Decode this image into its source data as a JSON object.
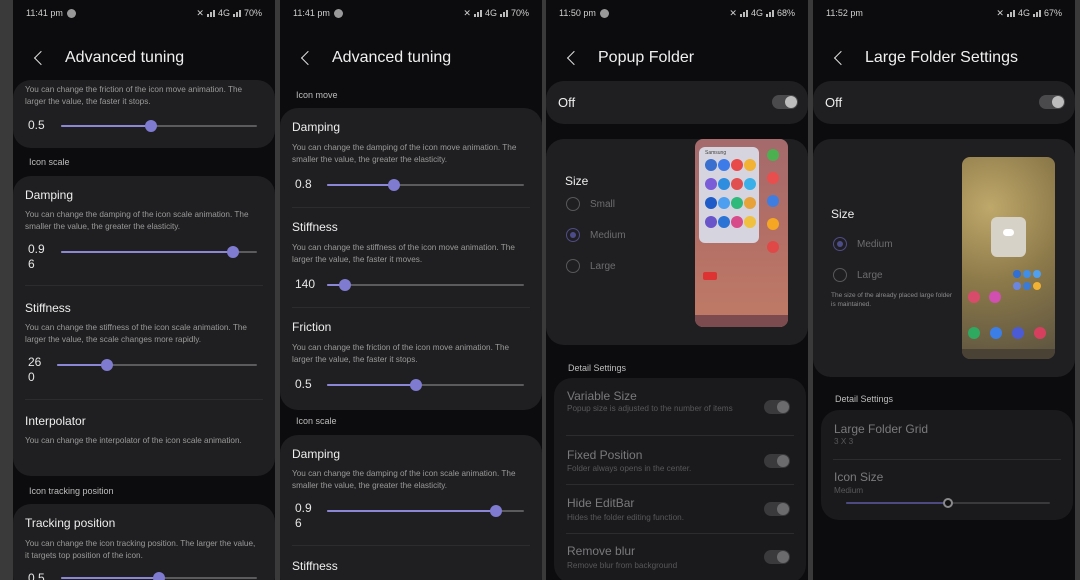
{
  "status": {
    "p1": {
      "time": "11:41 pm",
      "battery": "70%",
      "network": "4G"
    },
    "p2": {
      "time": "11:41 pm",
      "battery": "70%",
      "network": "4G"
    },
    "p3": {
      "time": "11:50 pm",
      "battery": "68%",
      "network": "4G"
    },
    "p4": {
      "time": "11:52 pm",
      "battery": "67%",
      "network": "4G"
    }
  },
  "p1": {
    "title": "Advanced tuning",
    "friction_desc": "You can change the friction of the icon move animation. The larger the value, the faster it stops.",
    "friction_value": "0.5",
    "section_icon_scale": "Icon scale",
    "damping_title": "Damping",
    "damping_desc": "You can change the damping of the icon scale animation. The smaller the value, the greater the elasticity.",
    "damping_value": "0.9\n6",
    "stiffness_title": "Stiffness",
    "stiffness_desc": "You can change the stiffness of the icon scale animation. The larger the value, the scale changes more rapidly.",
    "stiffness_value": "26\n0",
    "interpolator_title": "Interpolator",
    "interpolator_desc": "You can change the interpolator of the icon scale animation.",
    "section_tracking": "Icon tracking position",
    "tracking_title": "Tracking position",
    "tracking_desc": "You can change the icon tracking position. The larger the value, it targets top position of the icon.",
    "tracking_value": "0.5"
  },
  "p2": {
    "title": "Advanced tuning",
    "section_icon_move": "Icon move",
    "damping_title": "Damping",
    "damping_desc": "You can change the damping of the icon move animation. The smaller the value, the greater the elasticity.",
    "damping_value": "0.8",
    "stiffness_title": "Stiffness",
    "stiffness_desc": "You can change the stiffness of the icon move animation. The larger the value, the faster it moves.",
    "stiffness_value": "140",
    "friction_title": "Friction",
    "friction_desc": "You can change the friction of the icon move animation. The larger the value, the faster it stops.",
    "friction_value": "0.5",
    "section_icon_scale": "Icon scale",
    "scale_damping_title": "Damping",
    "scale_damping_desc": "You can change the damping of the icon scale animation. The smaller the value, the greater the elasticity.",
    "scale_damping_value": "0.9\n6",
    "scale_stiffness_title": "Stiffness"
  },
  "p3": {
    "title": "Popup Folder",
    "master_label": "Off",
    "size_label": "Size",
    "size_options": [
      "Small",
      "Medium",
      "Large"
    ],
    "preview_folder_name": "Samsung",
    "section_detail": "Detail Settings",
    "variable_title": "Variable Size",
    "variable_desc": "Popup size is adjusted to the number of items",
    "fixed_title": "Fixed Position",
    "fixed_desc": "Folder always opens in the center.",
    "editbar_title": "Hide EditBar",
    "editbar_desc": "Hides the folder editing function.",
    "blur_title": "Remove blur",
    "blur_desc": "Remove blur from background"
  },
  "p4": {
    "title": "Large Folder Settings",
    "master_label": "Off",
    "size_label": "Size",
    "size_options": [
      "Medium",
      "Large"
    ],
    "size_note": "The size of the already placed large folder is maintained.",
    "section_detail": "Detail Settings",
    "grid_title": "Large Folder Grid",
    "grid_value": "3 X 3",
    "iconsize_title": "Icon Size",
    "iconsize_value": "Medium"
  },
  "sliders": {
    "p1_friction": 0.46,
    "p1_damping": 0.88,
    "p1_stiffness": 0.25,
    "p1_tracking": 0.5,
    "p2_damping": 0.34,
    "p2_stiffness": 0.09,
    "p2_friction": 0.45,
    "p2_scale_damping": 0.86,
    "p4_iconsize": 0.5
  },
  "colors": {
    "accent": "#8b87d6",
    "card": "#1f1f21",
    "background": "#0c0c0e"
  }
}
